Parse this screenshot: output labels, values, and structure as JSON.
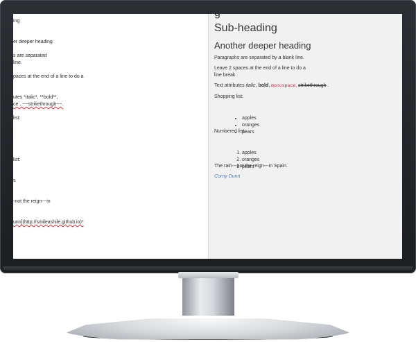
{
  "editor": {
    "lines": [
      "ing",
      "er deeper heading",
      "s are separated",
      " line.",
      "paces at the end of a line to do a",
      "utes *italic*, **bold**,",
      "ce`, ~~strikethrough~~.",
      "list:",
      " list:",
      "s",
      "-not the reign---in",
      "unn](http://smileashile.github.io)*"
    ]
  },
  "preview": {
    "top_heading_partial": "g",
    "h2": "Sub-heading",
    "h3": "Another deeper heading",
    "p1": "Paragraphs are separated by a blank line.",
    "p2_line1": "Leave 2 spaces at the end of a line to do a",
    "p2_line2": "line break",
    "attr_prefix": "Text attributes ",
    "attr_italic": "italic",
    "attr_sep1": ", ",
    "attr_bold": "bold",
    "attr_sep2": ", ",
    "attr_mono": "monospace",
    "attr_sep3": ", ",
    "attr_strike": "strikethrough",
    "attr_end": " .",
    "shopping_label": "Shopping list:",
    "shopping": [
      "apples",
      "oranges",
      "pears"
    ],
    "numbered_label": "Numbered list:",
    "numbered": [
      "apples",
      "oranges",
      "pears"
    ],
    "rain": "The rain---not the reign---in Spain.",
    "link": "Corny Dunn"
  }
}
